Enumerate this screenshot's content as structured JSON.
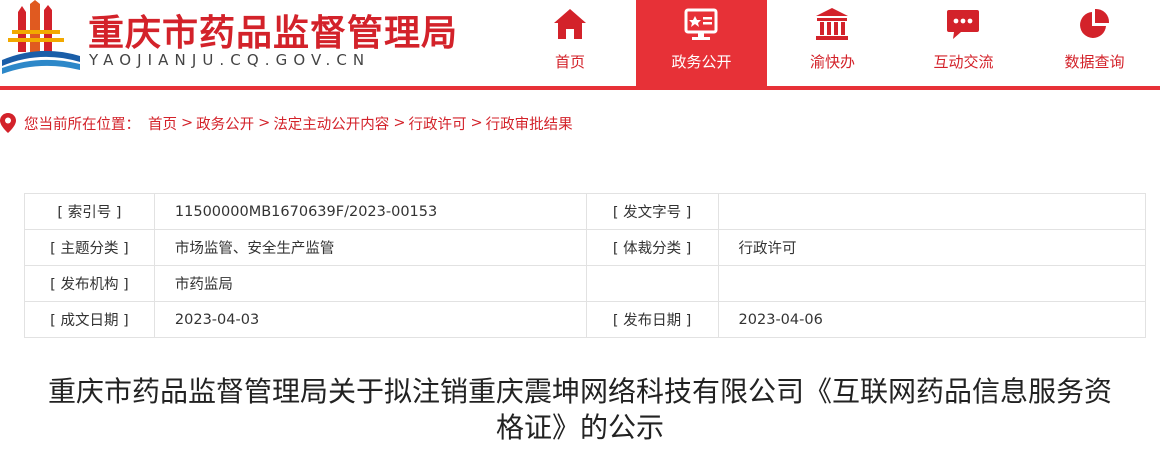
{
  "header": {
    "site_title": "重庆市药品监督管理局",
    "site_domain": "YAOJIANJU.CQ.GOV.CN",
    "logo_icon": "cq-emblem-logo",
    "brand_color": "#d3222a",
    "active_color": "#e73137"
  },
  "nav": {
    "items": [
      {
        "label": "首页",
        "icon": "home-icon"
      },
      {
        "label": "政务公开",
        "icon": "monitor-icon",
        "active": true
      },
      {
        "label": "渝快办",
        "icon": "government-building-icon"
      },
      {
        "label": "互动交流",
        "icon": "chat-bubble-icon"
      },
      {
        "label": "数据查询",
        "icon": "pie-chart-icon"
      }
    ]
  },
  "breadcrumb": {
    "prefix": "您当前所在位置：",
    "items": [
      "首页",
      "政务公开",
      "法定主动公开内容",
      "行政许可",
      "行政审批结果"
    ],
    "separator": ">"
  },
  "meta": {
    "rows": [
      [
        "[ 索引号 ]",
        "11500000MB1670639F/2023-00153",
        "[ 发文字号 ]",
        ""
      ],
      [
        "[ 主题分类 ]",
        "市场监管、安全生产监管",
        "[ 体裁分类 ]",
        "行政许可"
      ],
      [
        "[ 发布机构 ]",
        "市药监局",
        "",
        ""
      ],
      [
        "[ 成文日期 ]",
        "2023-04-03",
        "[ 发布日期 ]",
        "2023-04-06"
      ]
    ]
  },
  "article": {
    "title_line1": "重庆市药品监督管理局关于拟注销重庆震坤网络科技有限公司《互联网药品信息服务资",
    "title_line2": "格证》的公示"
  }
}
